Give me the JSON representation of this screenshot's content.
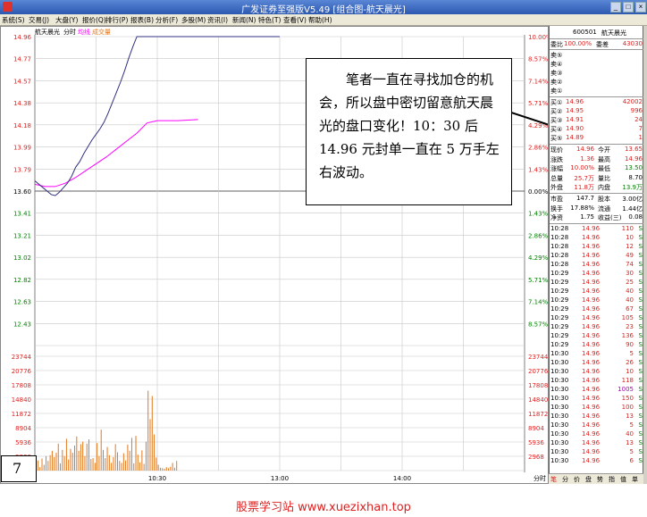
{
  "window": {
    "title": "广发证券至强版V5.49 [组合图-航天晨光]"
  },
  "menu": [
    "系统(S)",
    "交易(J)",
    "大盘(Y)",
    "报价(Q)",
    "排行(P)",
    "报表(B)",
    "分析(F)",
    "多股(M)",
    "资讯(I)",
    "新闻(N)",
    "特色(T)",
    "查看(V)",
    "帮助(H)"
  ],
  "chart": {
    "stock_name": "航天晨光",
    "legend_time": "分时",
    "legend_avg": "均线",
    "legend_vol": "成交量",
    "time_label": "分时",
    "colors": {
      "price_line": "#303080",
      "avg_line": "#ff00ff",
      "volume": "#e07820",
      "axis_text": "#e02020",
      "gridline": "#c8c8c8"
    }
  },
  "chart_data": {
    "type": "line",
    "price_ticks": [
      "14.96",
      "14.77",
      "14.57",
      "14.38",
      "14.18",
      "13.99",
      "13.79",
      "13.60",
      "13.41",
      "13.21",
      "13.02",
      "12.82",
      "12.63",
      "12.43"
    ],
    "percent_ticks": [
      "10.00%",
      "8.57%",
      "7.14%",
      "5.71%",
      "4.29%",
      "2.86%",
      "1.43%",
      "0.00%",
      "1.43%",
      "2.86%",
      "4.29%",
      "5.71%",
      "7.14%",
      "8.57%"
    ],
    "volume_ticks": [
      "23744",
      "20776",
      "17808",
      "14840",
      "11872",
      "8904",
      "5936",
      "2968"
    ],
    "x_ticks": [
      "10:30",
      "13:00",
      "14:00"
    ],
    "ylim": [
      12.24,
      14.96
    ],
    "price": [
      [
        0,
        13.69
      ],
      [
        2,
        13.66
      ],
      [
        4,
        13.63
      ],
      [
        6,
        13.6
      ],
      [
        8,
        13.57
      ],
      [
        10,
        13.56
      ],
      [
        12,
        13.59
      ],
      [
        14,
        13.63
      ],
      [
        16,
        13.67
      ],
      [
        18,
        13.73
      ],
      [
        20,
        13.81
      ],
      [
        22,
        13.86
      ],
      [
        24,
        13.93
      ],
      [
        26,
        13.99
      ],
      [
        28,
        14.05
      ],
      [
        30,
        14.1
      ],
      [
        32,
        14.15
      ],
      [
        34,
        14.21
      ],
      [
        36,
        14.29
      ],
      [
        38,
        14.38
      ],
      [
        40,
        14.47
      ],
      [
        42,
        14.56
      ],
      [
        44,
        14.66
      ],
      [
        46,
        14.77
      ],
      [
        48,
        14.87
      ],
      [
        50,
        14.96
      ],
      [
        60,
        14.96
      ],
      [
        75,
        14.96
      ],
      [
        90,
        14.96
      ],
      [
        105,
        14.96
      ],
      [
        120,
        14.96
      ]
    ],
    "avg": [
      [
        0,
        13.66
      ],
      [
        5,
        13.64
      ],
      [
        10,
        13.64
      ],
      [
        15,
        13.67
      ],
      [
        20,
        13.72
      ],
      [
        25,
        13.78
      ],
      [
        30,
        13.84
      ],
      [
        35,
        13.9
      ],
      [
        40,
        13.97
      ],
      [
        45,
        14.04
      ],
      [
        50,
        14.11
      ],
      [
        55,
        14.2
      ],
      [
        60,
        14.22
      ],
      [
        70,
        14.22
      ],
      [
        80,
        14.23
      ]
    ],
    "volume": [
      1100,
      2100,
      700,
      2500,
      1200,
      3000,
      2000,
      3200,
      4100,
      2800,
      3700,
      5600,
      1500,
      4300,
      3000,
      6600,
      2300,
      4500,
      3700,
      5200,
      7100,
      4100,
      5500,
      6000,
      3000,
      5600,
      6500,
      2400,
      2600,
      1600,
      5700,
      3000,
      8500,
      4300,
      2600,
      4900,
      3200,
      1600,
      2800,
      5500,
      3800,
      2000,
      1600,
      3600,
      2100,
      5400,
      4100,
      6800,
      1500,
      7200,
      3300,
      1700,
      4200,
      1400,
      6000,
      16600,
      10700,
      15500,
      7500,
      2700,
      1200,
      600,
      500,
      400,
      700,
      500,
      800,
      1600,
      600,
      2000
    ]
  },
  "note": {
    "text": "　　笔者一直在寻找加仓的机会，所以盘中密切留意航天晨光的盘口变化！10：30 后 14.96 元封单一直在 5 万手左右波动。"
  },
  "badge": "7",
  "footer": "股票学习站   www.xuezixhan.top",
  "panel": {
    "code": "600501",
    "name": "航天晨光",
    "weibi_label": "委比",
    "weibi_value": "100.00%",
    "weicha_label": "委差",
    "weicha_value": "43030",
    "sells": [
      {
        "label": "卖⑤",
        "price": "",
        "vol": ""
      },
      {
        "label": "卖④",
        "price": "",
        "vol": ""
      },
      {
        "label": "卖③",
        "price": "",
        "vol": ""
      },
      {
        "label": "卖②",
        "price": "",
        "vol": ""
      },
      {
        "label": "卖①",
        "price": "",
        "vol": ""
      }
    ],
    "buys": [
      {
        "label": "买①",
        "price": "14.96",
        "vol": "42002"
      },
      {
        "label": "买②",
        "price": "14.95",
        "vol": "996"
      },
      {
        "label": "买③",
        "price": "14.91",
        "vol": "24"
      },
      {
        "label": "买④",
        "price": "14.90",
        "vol": "7"
      },
      {
        "label": "买⑤",
        "price": "14.89",
        "vol": "1"
      }
    ],
    "quotes": [
      {
        "l1": "现价",
        "v1": "14.96",
        "c1": "red",
        "l2": "今开",
        "v2": "13.65",
        "c2": "red"
      },
      {
        "l1": "涨跌",
        "v1": "1.36",
        "c1": "red",
        "l2": "最高",
        "v2": "14.96",
        "c2": "red"
      },
      {
        "l1": "涨幅",
        "v1": "10.00%",
        "c1": "red",
        "l2": "最低",
        "v2": "13.50",
        "c2": "grn"
      },
      {
        "l1": "总量",
        "v1": "25.7万",
        "c1": "red",
        "l2": "量比",
        "v2": "8.70",
        "c2": "blk"
      },
      {
        "l1": "外盘",
        "v1": "11.8万",
        "c1": "red",
        "l2": "内盘",
        "v2": "13.9万",
        "c2": "grn"
      },
      {
        "l1": "市盈",
        "v1": "147.7",
        "c1": "blk",
        "l2": "股本",
        "v2": "3.00亿",
        "c2": "blk"
      },
      {
        "l1": "换手",
        "v1": "17.88%",
        "c1": "blk",
        "l2": "流通",
        "v2": "1.44亿",
        "c2": "blk"
      },
      {
        "l1": "净资",
        "v1": "1.75",
        "c1": "blk",
        "l2": "收益(三)",
        "v2": "0.08",
        "c2": "blk"
      }
    ],
    "trades": [
      {
        "time": "10:28",
        "price": "14.96",
        "vol": "110",
        "side": "S"
      },
      {
        "time": "10:28",
        "price": "14.96",
        "vol": "10",
        "side": "S"
      },
      {
        "time": "10:28",
        "price": "14.96",
        "vol": "12",
        "side": "S"
      },
      {
        "time": "10:28",
        "price": "14.96",
        "vol": "49",
        "side": "S"
      },
      {
        "time": "10:28",
        "price": "14.96",
        "vol": "74",
        "side": "S"
      },
      {
        "time": "10:29",
        "price": "14.96",
        "vol": "30",
        "side": "S"
      },
      {
        "time": "10:29",
        "price": "14.96",
        "vol": "25",
        "side": "S"
      },
      {
        "time": "10:29",
        "price": "14.96",
        "vol": "40",
        "side": "S"
      },
      {
        "time": "10:29",
        "price": "14.96",
        "vol": "40",
        "side": "S"
      },
      {
        "time": "10:29",
        "price": "14.96",
        "vol": "67",
        "side": "S"
      },
      {
        "time": "10:29",
        "price": "14.96",
        "vol": "105",
        "side": "S"
      },
      {
        "time": "10:29",
        "price": "14.96",
        "vol": "23",
        "side": "S"
      },
      {
        "time": "10:29",
        "price": "14.96",
        "vol": "136",
        "side": "S"
      },
      {
        "time": "10:29",
        "price": "14.96",
        "vol": "90",
        "side": "S"
      },
      {
        "time": "10:30",
        "price": "14.96",
        "vol": "5",
        "side": "S"
      },
      {
        "time": "10:30",
        "price": "14.96",
        "vol": "26",
        "side": "S"
      },
      {
        "time": "10:30",
        "price": "14.96",
        "vol": "10",
        "side": "S"
      },
      {
        "time": "10:30",
        "price": "14.96",
        "vol": "118",
        "side": "S"
      },
      {
        "time": "10:30",
        "price": "14.96",
        "vol": "1005",
        "side": "S"
      },
      {
        "time": "10:30",
        "price": "14.96",
        "vol": "150",
        "side": "S"
      },
      {
        "time": "10:30",
        "price": "14.96",
        "vol": "100",
        "side": "S"
      },
      {
        "time": "10:30",
        "price": "14.96",
        "vol": "13",
        "side": "S"
      },
      {
        "time": "10:30",
        "price": "14.96",
        "vol": "5",
        "side": "S"
      },
      {
        "time": "10:30",
        "price": "14.96",
        "vol": "40",
        "side": "S"
      },
      {
        "time": "10:30",
        "price": "14.96",
        "vol": "13",
        "side": "S"
      },
      {
        "time": "10:30",
        "price": "14.96",
        "vol": "5",
        "side": "S"
      },
      {
        "time": "10:30",
        "price": "14.96",
        "vol": "6",
        "side": "S"
      }
    ],
    "tabs": [
      "笔",
      "分",
      "价",
      "盘",
      "势",
      "指",
      "值",
      "单"
    ]
  }
}
